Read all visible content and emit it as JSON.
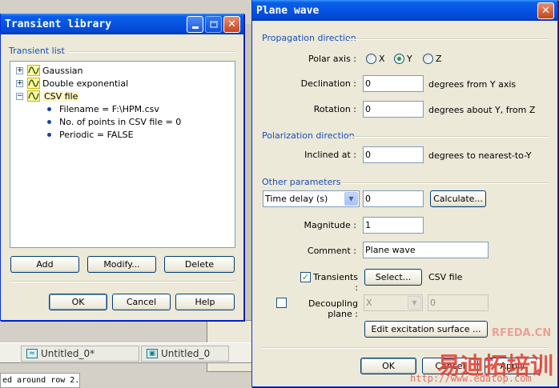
{
  "background": {
    "tabs": [
      {
        "label": "Untitled_0*",
        "icon": "waveform-icon"
      },
      {
        "label": "Untitled_0",
        "icon": "device-icon"
      }
    ],
    "status_text": "ed around row 2."
  },
  "transient_library": {
    "title": "Transient library",
    "list_label": "Transient list",
    "tree": [
      {
        "label": "Gaussian",
        "expanded": false
      },
      {
        "label": "Double exponential",
        "expanded": false
      },
      {
        "label": "CSV file",
        "expanded": true,
        "selected": true,
        "children": [
          "Filename = F:\\HPM.csv",
          "No. of points in CSV file = 0",
          "Periodic = FALSE"
        ]
      }
    ],
    "buttons": {
      "add": "Add",
      "modify": "Modify...",
      "delete": "Delete",
      "ok": "OK",
      "cancel": "Cancel",
      "help": "Help"
    }
  },
  "plane_wave": {
    "title": "Plane wave",
    "propagation": {
      "heading": "Propagation direction",
      "polar_axis_label": "Polar axis :",
      "axes": [
        "X",
        "Y",
        "Z"
      ],
      "selected_axis": "Y",
      "declination_label": "Declination :",
      "declination_value": "0",
      "declination_unit": "degrees from Y axis",
      "rotation_label": "Rotation :",
      "rotation_value": "0",
      "rotation_unit": "degrees about Y, from Z"
    },
    "polarization": {
      "heading": "Polarization direction",
      "inclined_label": "Inclined at :",
      "inclined_value": "0",
      "inclined_unit": "degrees to nearest-to-Y"
    },
    "other": {
      "heading": "Other parameters",
      "time_select": "Time delay (s)",
      "time_value": "0",
      "calculate_button": "Calculate...",
      "magnitude_label": "Magnitude :",
      "magnitude_value": "1",
      "comment_label": "Comment :",
      "comment_value": "Plane wave",
      "transients_label": "Transients :",
      "transients_checked": true,
      "select_button": "Select...",
      "transients_value": "CSV file",
      "decoupling_label": "Decoupling plane :",
      "decoupling_checked": false,
      "decoupling_axis": "X",
      "decoupling_value": "0",
      "edit_surface_button": "Edit excitation surface ..."
    },
    "buttons": {
      "ok": "OK",
      "cancel": "Cancel",
      "apply": "Apply"
    }
  },
  "watermark": {
    "brand": "RFEDA.CN",
    "cn_text": "易迪拓培训",
    "url": "http://www.edatop.com"
  },
  "colors": {
    "accent": "#1b4eb8",
    "titlebar": "#0554e2",
    "close": "#c6441b",
    "watermark": "#e0463c"
  }
}
